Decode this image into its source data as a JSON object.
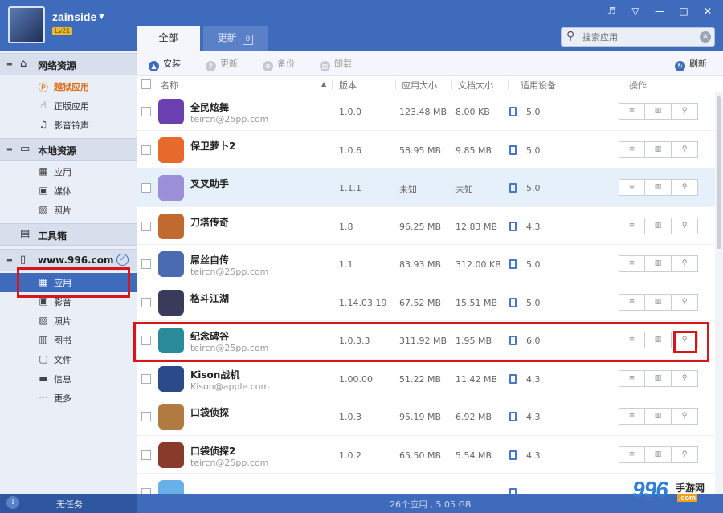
{
  "user": {
    "name": "zainside",
    "level": "Lv21"
  },
  "window_buttons": [
    "♬",
    "▽",
    "—",
    "□",
    "✕"
  ],
  "tabs": {
    "all": "全部",
    "update": "更新",
    "update_count": "0"
  },
  "search": {
    "placeholder": "搜索应用"
  },
  "sidebar": {
    "online": {
      "label": "网络资源",
      "items": [
        "越狱应用",
        "正版应用",
        "影音铃声"
      ]
    },
    "local": {
      "label": "本地资源",
      "items": [
        "应用",
        "媒体",
        "照片"
      ]
    },
    "tools": {
      "label": "工具箱"
    },
    "device": {
      "label": "www.996.com",
      "items": [
        "应用",
        "影音",
        "照片",
        "图书",
        "文件",
        "信息",
        "更多"
      ]
    }
  },
  "toolbar": {
    "install": "安装",
    "update": "更新",
    "backup": "备份",
    "uninstall": "卸载",
    "refresh": "刷新"
  },
  "columns": {
    "name": "名称",
    "version": "版本",
    "app_size": "应用大小",
    "doc_size": "文档大小",
    "device": "适用设备",
    "ops": "操作"
  },
  "apps": [
    {
      "name": "全民炫舞",
      "developer": "teircn@25pp.com",
      "version": "1.0.0",
      "app_size": "123.48 MB",
      "doc_size": "8.00 KB",
      "os": "5.0",
      "color": "#6b3fb0"
    },
    {
      "name": "保卫萝卜2",
      "developer": "",
      "version": "1.0.6",
      "app_size": "58.95 MB",
      "doc_size": "9.85 MB",
      "os": "5.0",
      "color": "#e86a2a"
    },
    {
      "name": "叉叉助手",
      "developer": "",
      "version": "1.1.1",
      "app_size": "未知",
      "doc_size": "未知",
      "os": "5.0",
      "color": "#9a8fd8"
    },
    {
      "name": "刀塔传奇",
      "developer": "",
      "version": "1.8",
      "app_size": "96.25 MB",
      "doc_size": "12.83 MB",
      "os": "4.3",
      "color": "#c06a30"
    },
    {
      "name": "屌丝自传",
      "developer": "teircn@25pp.com",
      "version": "1.1",
      "app_size": "83.93 MB",
      "doc_size": "312.00 KB",
      "os": "5.0",
      "color": "#4a6bb0"
    },
    {
      "name": "格斗江湖",
      "developer": "",
      "version": "1.14.03.19",
      "app_size": "67.52 MB",
      "doc_size": "15.51 MB",
      "os": "5.0",
      "color": "#3a3a5a"
    },
    {
      "name": "纪念碑谷",
      "developer": "teircn@25pp.com",
      "version": "1.0.3.3",
      "app_size": "311.92 MB",
      "doc_size": "1.95 MB",
      "os": "6.0",
      "color": "#2a8a9a"
    },
    {
      "name": "Kison战机",
      "developer": "Kison@apple.com",
      "version": "1.00.00",
      "app_size": "51.22 MB",
      "doc_size": "11.42 MB",
      "os": "4.3",
      "color": "#2a4a8a"
    },
    {
      "name": "口袋侦探",
      "developer": "",
      "version": "1.0.3",
      "app_size": "95.19 MB",
      "doc_size": "6.92 MB",
      "os": "4.3",
      "color": "#b07a40"
    },
    {
      "name": "口袋侦探2",
      "developer": "teircn@25pp.com",
      "version": "1.0.2",
      "app_size": "65.50 MB",
      "doc_size": "5.54 MB",
      "os": "4.3",
      "color": "#8a3a2a"
    },
    {
      "name": "",
      "developer": "",
      "version": "",
      "app_size": "",
      "doc_size": "",
      "os": "",
      "color": "#6ab0e8"
    }
  ],
  "bottom": {
    "tasks": "无任务",
    "status": "26个应用 , 5.05 GB"
  },
  "watermark": {
    "number": "996",
    "text": "手游网",
    "tld": ".com"
  },
  "colors": {
    "accent": "#3f6bbd",
    "highlight": "#d8151a",
    "selected_row": "#e6f0fa"
  }
}
